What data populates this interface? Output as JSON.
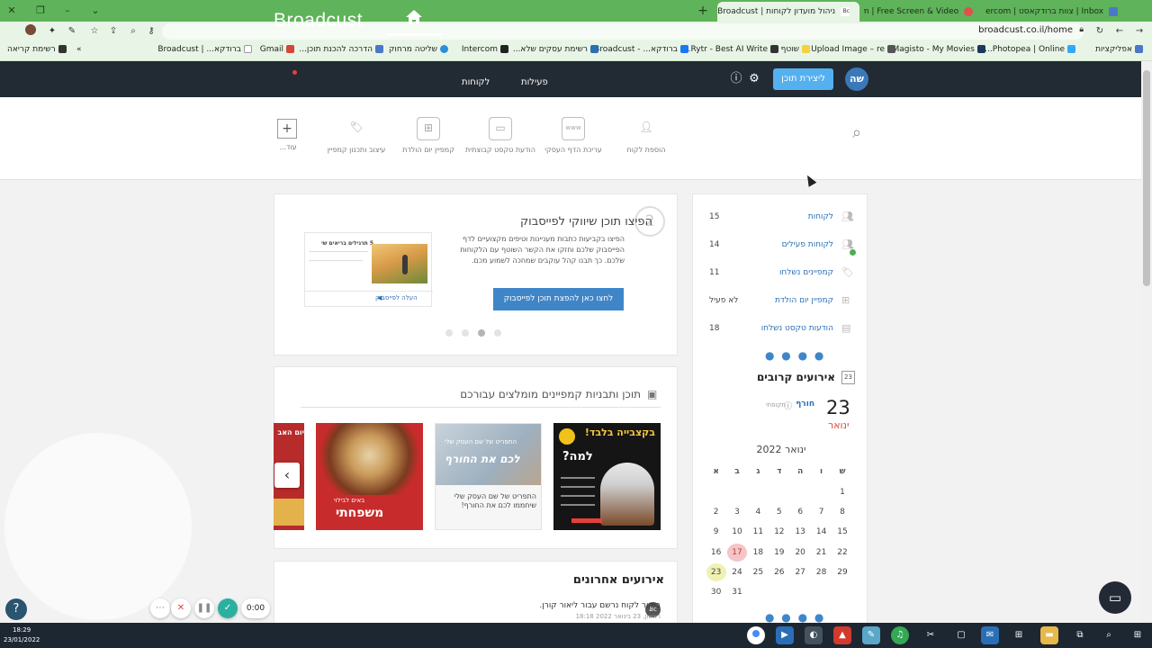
{
  "browser": {
    "tabs": [
      {
        "title": "ניהול מועדון לקוחות | Broadcust",
        "active": true
      },
      {
        "title": "Loom | Free Screen & Video",
        "active": false
      },
      {
        "title": "Inbox | צוות ברודקאסט | Intercom",
        "active": false
      }
    ],
    "url": "broadcust.co.il/home",
    "bookmarks": [
      "אפליקציות",
      "Photopea | Online...",
      "Magisto - My Movies",
      "Upload Image – re...",
      "שוטף",
      "Rytr - Best AI Write...",
      "ברודקא... - Broadcust",
      "רשימת עסקים שלא...",
      "Intercom",
      "שליטה מרחוק",
      "הדרכה להכנת תוכן...",
      "Gmail",
      "ברודקא... | Broadcust",
      "רשימת קריאה"
    ]
  },
  "header": {
    "logo_text": "Broadcust",
    "nav": [
      "לקוחות",
      "פעילות"
    ],
    "create_button": "ליצירת תוכן",
    "avatar": "שה"
  },
  "quick_actions": [
    {
      "label": "הוספת לקוח",
      "icon": "add-user-icon"
    },
    {
      "label": "עריכת הדף העסקי",
      "icon": "web-page-icon"
    },
    {
      "label": "הודעת טקסט קבוצתית",
      "icon": "chat-bubbles-icon"
    },
    {
      "label": "קמפיין יום הולדת",
      "icon": "gift-icon"
    },
    {
      "label": "עיצוב ותכנון קמפיין",
      "icon": "tag-icon"
    },
    {
      "label": "עוד...",
      "icon": "plus-icon"
    }
  ],
  "promo": {
    "step": "2",
    "title": "הפיצו תוכן שיווקי לפייסבוק",
    "text": "הפיצו בקביעות כתבות מעניינות וטיפים מקצועיים לדף הפייסבוק שלכם וחזקו את הקשר השוטף עם הלקוחות שלכם. כך תבנו קהל עוקבים שמחכה לשמוע מכם.",
    "button": "לחצו כאן להפצת תוכן לפייסבוק",
    "preview_caption": "העלה לפייסבוק",
    "preview_heading": "5 תרגילים בריאים שי",
    "dots": 4,
    "active_dot": 1
  },
  "templates": {
    "title": "תוכן ותבניות קמפיינים מומלצים עבורכם",
    "items": [
      {
        "headline": "בקצבייה בלבד!",
        "sub": "למה?",
        "caption": ""
      },
      {
        "headline": "לכם את החורף",
        "sub": "התפריט של שם העסק שלי",
        "caption": "התפריט של שם העסק שלי שיחממו לכם את החורף!"
      },
      {
        "headline": "משפחתי",
        "sub": "באים לבילוי",
        "caption": ""
      },
      {
        "headline": "יום האב",
        "sub": "",
        "caption": ""
      }
    ]
  },
  "recent": {
    "title": "אירועים אחרונים",
    "text": "ביקור לקוח נרשם עבור ליאור קורן.",
    "time": "ראשון, 23 בינואר 2022 18:18",
    "badge": "Bc"
  },
  "stats": [
    {
      "label": "לקוחות",
      "value": "15",
      "icon": "users-icon"
    },
    {
      "label": "לקוחות פעילים",
      "value": "14",
      "icon": "active-users-icon"
    },
    {
      "label": "קמפיינים נשלחו",
      "value": "11",
      "icon": "tag-icon"
    },
    {
      "label": "קמפיין יום הולדת",
      "value": "לא פעיל",
      "icon": "gift-icon"
    },
    {
      "label": "הודעות טקסט נשלחו",
      "value": "18",
      "icon": "message-icon"
    }
  ],
  "events": {
    "title": "אירועים קרובים",
    "calendar_icon_day": "23",
    "day": "23",
    "month": "ינואר",
    "name": "חורף",
    "sub": "תקופתי"
  },
  "calendar": {
    "month_label": "ינואר 2022",
    "weekdays": [
      "ש",
      "ו",
      "ה",
      "ד",
      "ג",
      "ב",
      "א"
    ],
    "rows": [
      [
        "1",
        "",
        "",
        "",
        "",
        "",
        ""
      ],
      [
        "8",
        "7",
        "6",
        "5",
        "4",
        "3",
        "2"
      ],
      [
        "15",
        "14",
        "13",
        "12",
        "11",
        "10",
        "9"
      ],
      [
        "22",
        "21",
        "20",
        "19",
        "18",
        "17",
        "16"
      ],
      [
        "29",
        "28",
        "27",
        "26",
        "25",
        "24",
        "23"
      ],
      [
        "",
        "",
        "",
        "",
        "",
        "31",
        "30"
      ]
    ],
    "highlight_red": "17",
    "highlight_yellow": "23"
  },
  "recorder": {
    "time": "0:00"
  },
  "taskbar": {
    "time": "18:29",
    "date": "23/01/2022"
  }
}
